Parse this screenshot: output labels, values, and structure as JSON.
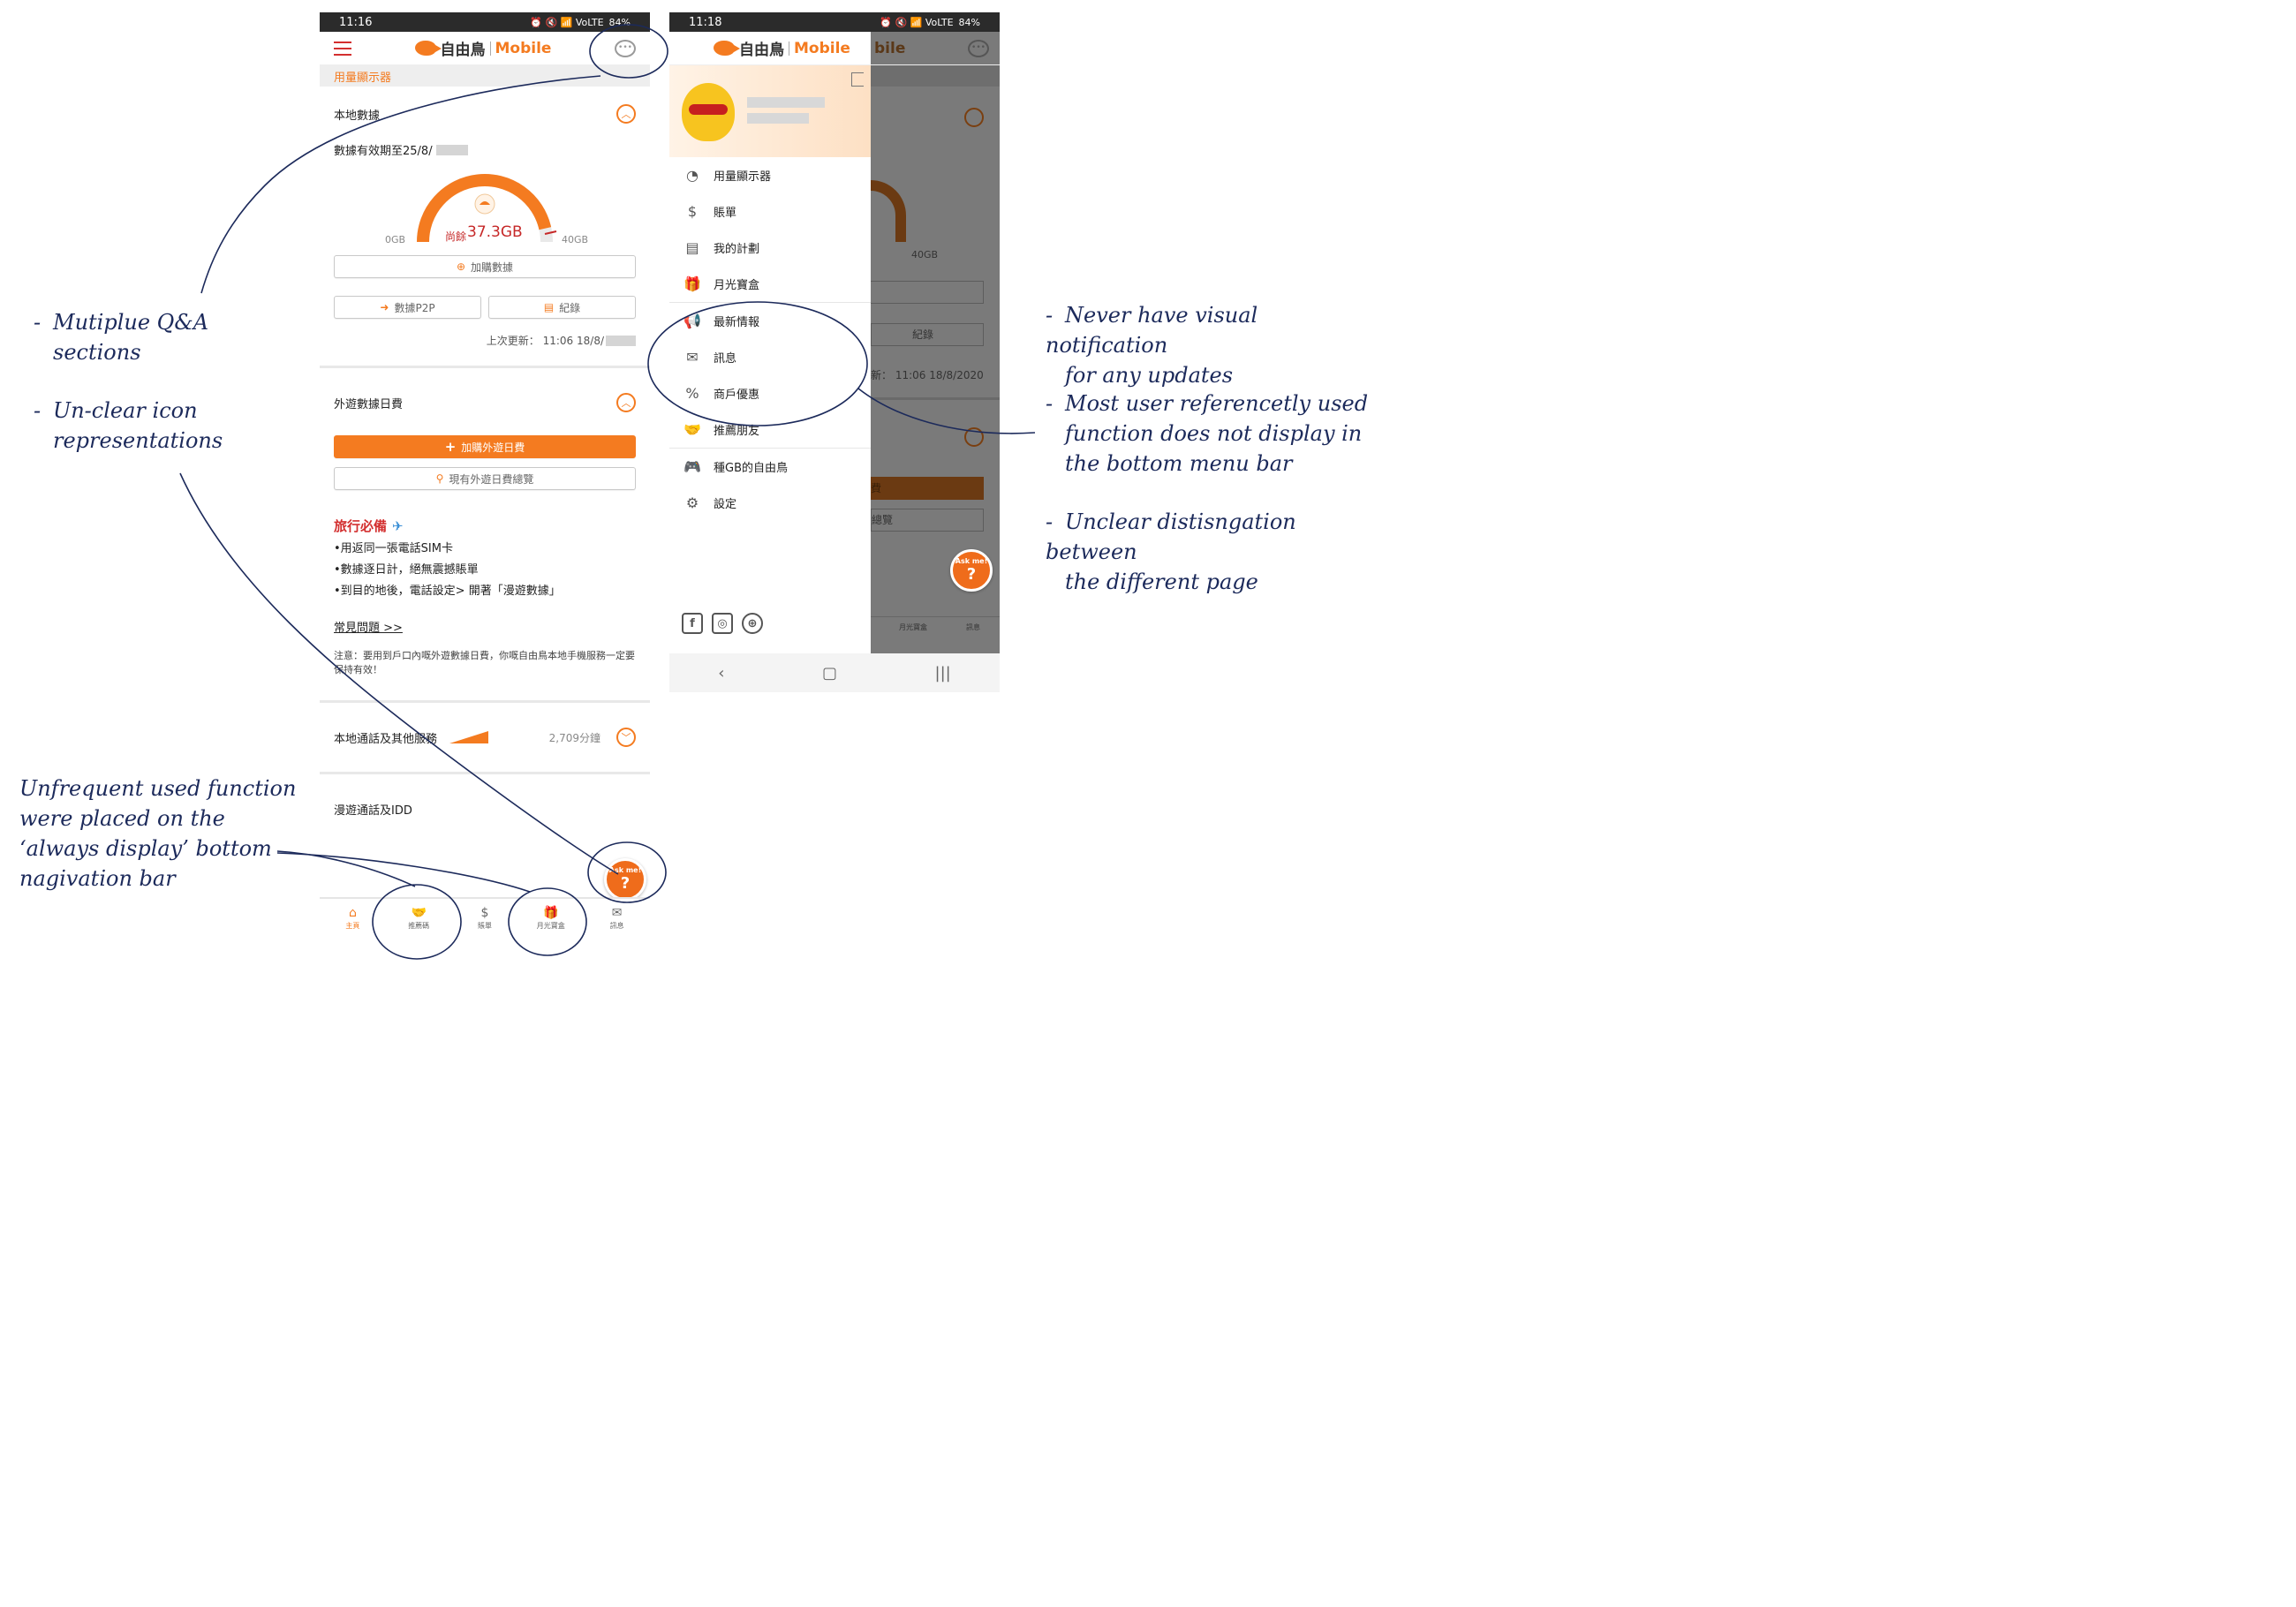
{
  "left_screen": {
    "status": {
      "time": "11:16",
      "battery": "84%",
      "icons": "⏰ 🔇 📶 VoLTE"
    },
    "appbar": {
      "logo_cn": "自由鳥",
      "logo_en": "Mobile"
    },
    "section_tag": "用量顯示器",
    "local_data": {
      "title": "本地數據",
      "validity": "數據有效期至25/8/",
      "gauge_min": "0GB",
      "gauge_max": "40GB",
      "remaining_prefix": "尚餘",
      "remaining_value": "37.3GB",
      "remaining_fraction": 0.93,
      "buy_data": "加購數據",
      "p2p": "數據P2P",
      "records": "紀錄",
      "last_update": "上次更新： 11:06 18/8/"
    },
    "roaming": {
      "title": "外遊數據日費",
      "buy_roaming": "加購外遊日費",
      "overview": "現有外遊日費總覽"
    },
    "travel": {
      "heading": "旅行必備",
      "lines": [
        "•用返同一張電話SIM卡",
        "•數據逐日計，絕無震撼賬單",
        "•到目的地後，電話設定> 開著「漫遊數據」"
      ],
      "faq": "常見問題 >>",
      "notice": "注意：要用到戶口內嘅外遊數據日費，你嘅自由鳥本地手機服務一定要保持有效！"
    },
    "local_calls": {
      "title": "本地通話及其他服務",
      "value": "2,709分鐘"
    },
    "roaming_idd": {
      "title": "漫遊通話及IDD"
    },
    "askme": "Ask me!",
    "bottom_nav": [
      {
        "label": "主頁",
        "icon": "⌂",
        "active": true
      },
      {
        "label": "推薦碼",
        "icon": "🤝",
        "active": false
      },
      {
        "label": "賬單",
        "icon": "$",
        "active": false
      },
      {
        "label": "月光寶盒",
        "icon": "🎁",
        "active": false
      },
      {
        "label": "訊息",
        "icon": "✉",
        "active": false
      }
    ]
  },
  "right_screen": {
    "status": {
      "time": "11:18",
      "battery": "84%",
      "icons": "⏰ 🔇 📶 VoLTE"
    },
    "appbar": {
      "logo_cn": "自由鳥",
      "logo_en": "Mobile",
      "behind_text": "bile"
    },
    "menu_groups": [
      [
        {
          "label": "用量顯示器",
          "icon": "◔"
        },
        {
          "label": "賬單",
          "icon": "$"
        },
        {
          "label": "我的計劃",
          "icon": "▤"
        },
        {
          "label": "月光寶盒",
          "icon": "🎁"
        }
      ],
      [
        {
          "label": "最新情報",
          "icon": "📢"
        },
        {
          "label": "訊息",
          "icon": "✉"
        },
        {
          "label": "商戶優惠",
          "icon": "%"
        },
        {
          "label": "推薦朋友",
          "icon": "🤝"
        }
      ],
      [
        {
          "label": "種GB的自由鳥",
          "icon": "🎮"
        },
        {
          "label": "設定",
          "icon": "⚙"
        }
      ]
    ],
    "social": [
      "f",
      "◎",
      "⊕"
    ],
    "behind": {
      "max": "40GB",
      "records": "紀錄",
      "update": "新： 11:06 18/8/2020",
      "fee": "費",
      "overview": "總覽",
      "nav_gift": "月光寶盒",
      "nav_msg": "訊息"
    },
    "sysnav": [
      "‹",
      "▢",
      "|||"
    ]
  },
  "annotations": {
    "left_top": [
      "Mutiplue Q&A",
      "sections"
    ],
    "left_mid": [
      "Un-clear icon",
      "representations"
    ],
    "left_bottom": [
      "Unfrequent used function",
      "were placed on the",
      "‘always display’ bottom",
      "nagivation bar"
    ],
    "right_1": [
      "Never have visual notification",
      "for any updates"
    ],
    "right_2": [
      "Most user referencetly used",
      "function does not display in",
      "the bottom menu bar"
    ],
    "right_3": [
      "Unclear distisngation between",
      "the different page"
    ]
  },
  "colors": {
    "brand_orange": "#f47b20",
    "menu_red": "#d32f2f",
    "ink_blue": "#1c2a5b",
    "status_bar": "#2b2b2b"
  }
}
